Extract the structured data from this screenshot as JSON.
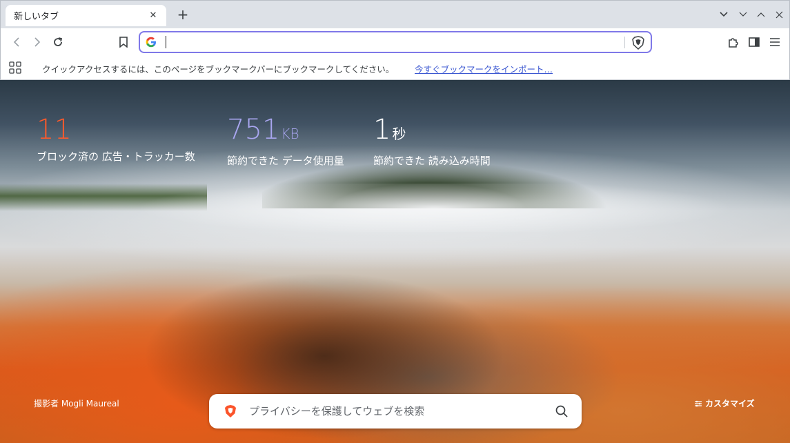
{
  "tab": {
    "title": "新しいタブ"
  },
  "toolbar": {
    "omnibox_value": ""
  },
  "bookmarks_bar": {
    "message": "クイックアクセスするには、このページをブックマークバーにブックマークしてください。",
    "import_link": "今すぐブックマークをインポート…"
  },
  "stats": {
    "blocked": {
      "value": "11",
      "label": "ブロック済の 広告・トラッカー数",
      "color": "#ff5a2a"
    },
    "data_saved": {
      "value": "751",
      "unit": "KB",
      "label": "節約できた データ使用量",
      "color": "#a9a6f0"
    },
    "time_saved": {
      "value": "1",
      "unit": "秒",
      "label": "節約できた 読み込み時間",
      "color": "#ffffff"
    }
  },
  "photo_credit": "撮影者 Mogli Maureal",
  "search": {
    "placeholder": "プライバシーを保護してウェブを検索"
  },
  "customize_label": "カスタマイズ",
  "colors": {
    "omnibox_border": "#7f78e8",
    "brave_orange": "#fb542b",
    "link": "#3b57d1"
  }
}
